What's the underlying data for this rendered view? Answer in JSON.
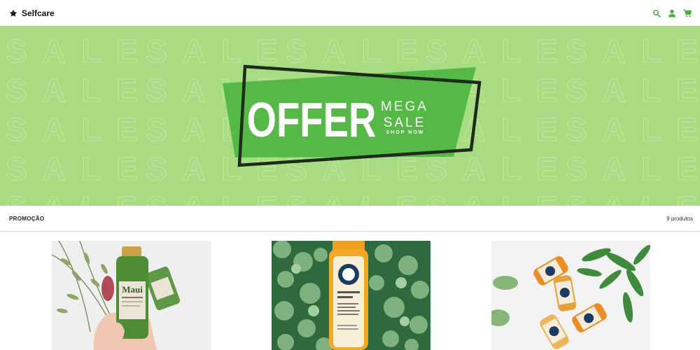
{
  "header": {
    "brand": "Selfcare",
    "icons": [
      "star-icon",
      "search-icon",
      "user-icon",
      "cart-icon"
    ],
    "accent": "#4caf3f"
  },
  "banner": {
    "background_word": "SALE",
    "headline": "OFFER",
    "sub1": "MEGA",
    "sub2": "SALE",
    "cta": "SHOP NOW",
    "colors": {
      "background": "#a8dc82",
      "panel": "#56b846",
      "frame": "#1e2a1b"
    }
  },
  "section": {
    "title": "PROMOÇÃO",
    "count": "9 produtos"
  },
  "products": [
    {
      "name": "Maui shampoo bottle in hand"
    },
    {
      "name": "Vitality shot juice bottle on leaves"
    },
    {
      "name": "Juice bottles with plant"
    }
  ]
}
